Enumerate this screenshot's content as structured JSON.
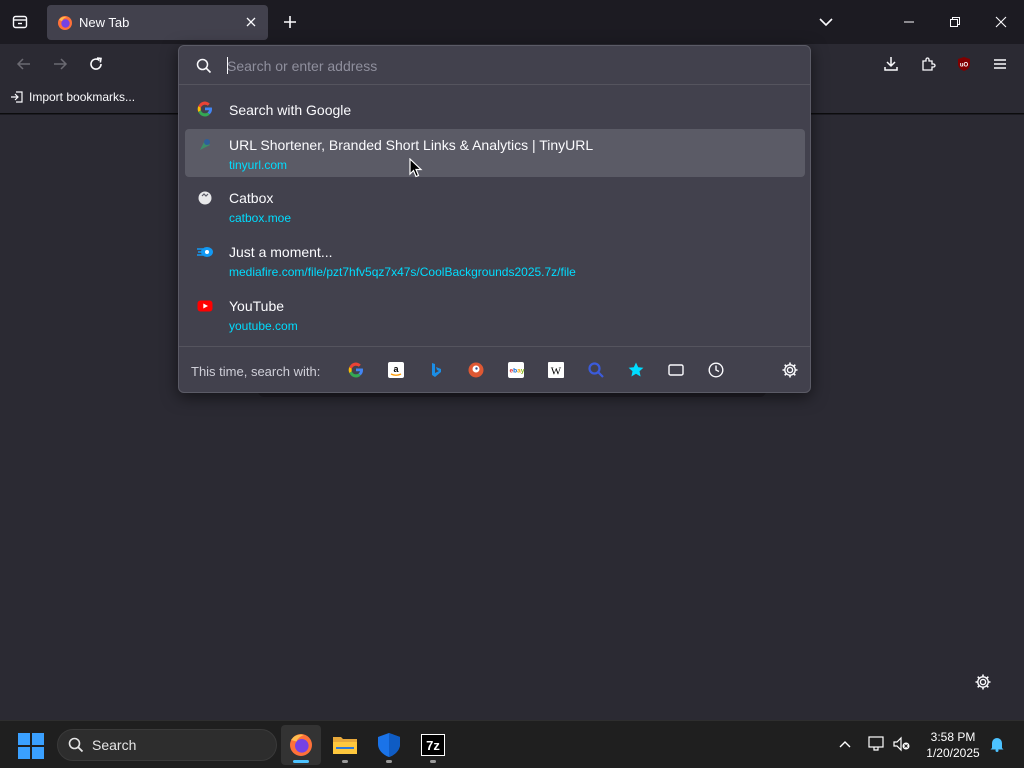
{
  "tabs": [
    {
      "title": "New Tab"
    }
  ],
  "bookmarks": {
    "import_label": "Import bookmarks..."
  },
  "urlbar": {
    "placeholder": "Search or enter address",
    "value": ""
  },
  "results": {
    "search_with": "Search with Google",
    "items": [
      {
        "title": "URL Shortener, Branded Short Links & Analytics | TinyURL",
        "url": "tinyurl.com",
        "icon": "tinyurl-icon",
        "selected": true
      },
      {
        "title": "Catbox",
        "url": "catbox.moe",
        "icon": "catbox-icon",
        "selected": false
      },
      {
        "title": "Just a moment...",
        "url": "mediafire.com/file/pzt7hfv5qz7x47s/CoolBackgrounds2025.7z/file",
        "icon": "mediafire-icon",
        "selected": false
      },
      {
        "title": "YouTube",
        "url": "youtube.com",
        "icon": "youtube-icon",
        "selected": false
      }
    ]
  },
  "one_off": {
    "label": "This time, search with:",
    "engines": [
      "google",
      "amazon",
      "bing",
      "duckduckgo",
      "ebay",
      "wikipedia",
      "search",
      "bookmarks",
      "tabs",
      "history"
    ]
  },
  "taskbar": {
    "search_label": "Search",
    "time": "3:58 PM",
    "date": "1/20/2025"
  },
  "colors": {
    "accent": "#00ddff",
    "popup_bg": "#42414d",
    "selected_row": "#5b5b66",
    "windows_blue": "#3aa0ff"
  }
}
